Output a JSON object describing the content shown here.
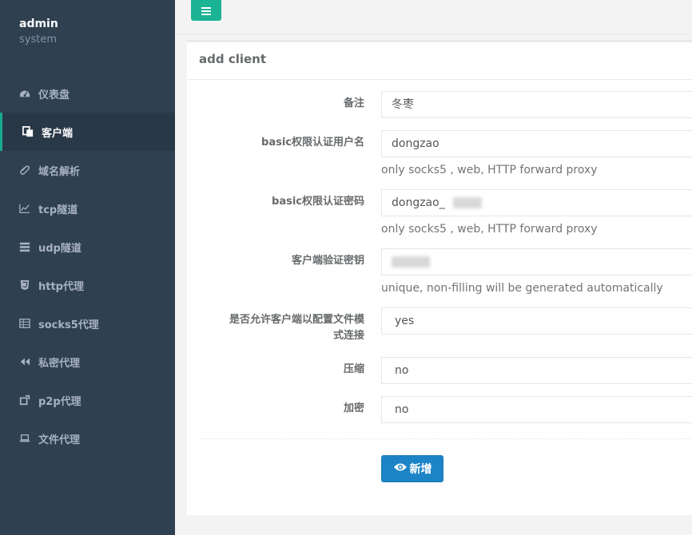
{
  "sidebar": {
    "user": "admin",
    "role": "system",
    "items": [
      {
        "label": "仪表盘",
        "icon": "dashboard-icon"
      },
      {
        "label": "客户端",
        "icon": "clone-icon",
        "active": true
      },
      {
        "label": "域名解析",
        "icon": "paperclip-icon"
      },
      {
        "label": "tcp隧道",
        "icon": "line-chart-icon"
      },
      {
        "label": "udp隧道",
        "icon": "server-icon"
      },
      {
        "label": "http代理",
        "icon": "html5-icon"
      },
      {
        "label": "socks5代理",
        "icon": "table-icon"
      },
      {
        "label": "私密代理",
        "icon": "backward-icon"
      },
      {
        "label": "p2p代理",
        "icon": "share-square-icon"
      },
      {
        "label": "文件代理",
        "icon": "laptop-icon"
      }
    ]
  },
  "topbar": {
    "menu_icon": "bars-icon"
  },
  "panel": {
    "title": "add client",
    "remark": {
      "label": "备注",
      "value": "冬枣"
    },
    "basic_user": {
      "label": "basic权限认证用户名",
      "value": "dongzao",
      "help": "only socks5 , web, HTTP forward proxy"
    },
    "basic_pass": {
      "label": "basic权限认证密码",
      "value": "dongzao_",
      "help": "only socks5 , web, HTTP forward proxy"
    },
    "vkey": {
      "label": "客户端验证密钥",
      "value": "",
      "help": "unique, non-filling will be generated automatically"
    },
    "config_conn": {
      "label_line1": "是否允许客户端以配置文件模",
      "label_line2": "式连接",
      "value": "yes"
    },
    "compress": {
      "label": "压缩",
      "value": "no"
    },
    "crypt": {
      "label": "加密",
      "value": "no"
    },
    "submit_label": "新增",
    "submit_icon": "eye-icon"
  },
  "colors": {
    "sidebar_bg": "#2f4050",
    "sidebar_active_bg": "#293846",
    "accent": "#1ab394",
    "primary_button": "#1c84c6"
  }
}
